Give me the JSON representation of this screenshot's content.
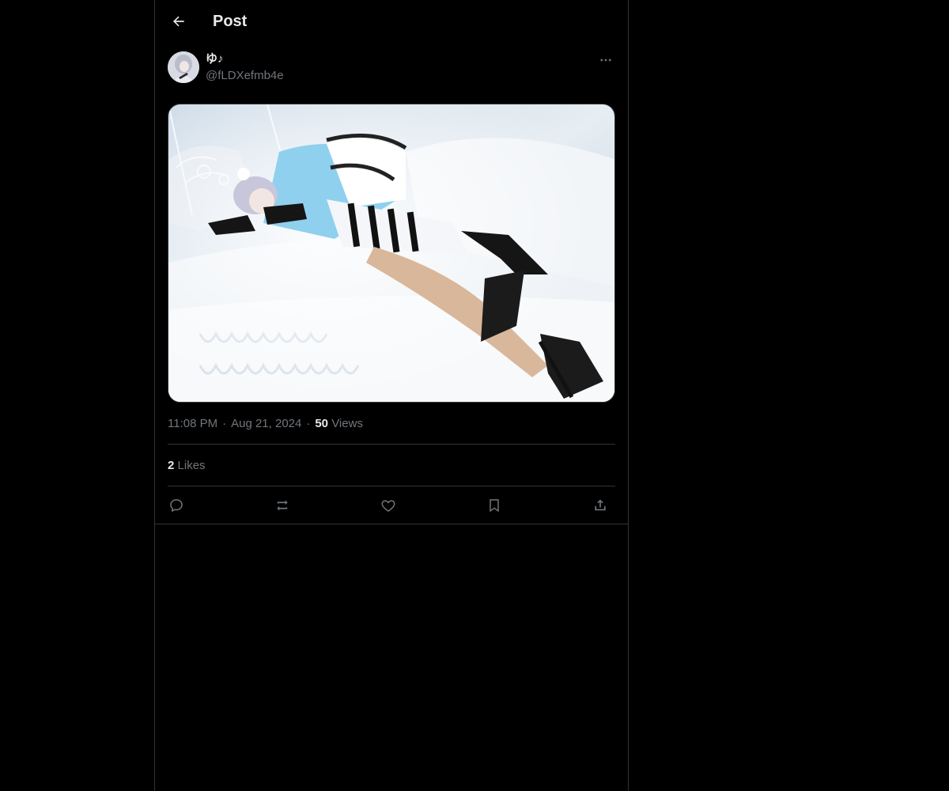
{
  "header": {
    "title": "Post",
    "back_icon": "arrow-left-icon"
  },
  "author": {
    "display_name": "ゆ♪",
    "handle": "@fLDXefmb4e",
    "more_icon": "more-horizontal-icon"
  },
  "post": {
    "media_alt": "Cosplay photo: person in light-blue maid costume with striped stockings and black heels lying on a white bed"
  },
  "meta": {
    "time": "11:08 PM",
    "separator": "·",
    "date": "Aug 21, 2024",
    "views_count": "50",
    "views_label": "Views"
  },
  "stats": {
    "likes_count": "2",
    "likes_label": "Likes"
  },
  "actions": {
    "reply_icon": "reply-icon",
    "repost_icon": "repost-icon",
    "like_icon": "heart-icon",
    "bookmark_icon": "bookmark-icon",
    "share_icon": "share-icon"
  },
  "colors": {
    "background": "#000000",
    "border": "#2f3336",
    "text_primary": "#e7e9ea",
    "text_secondary": "#71767b"
  }
}
